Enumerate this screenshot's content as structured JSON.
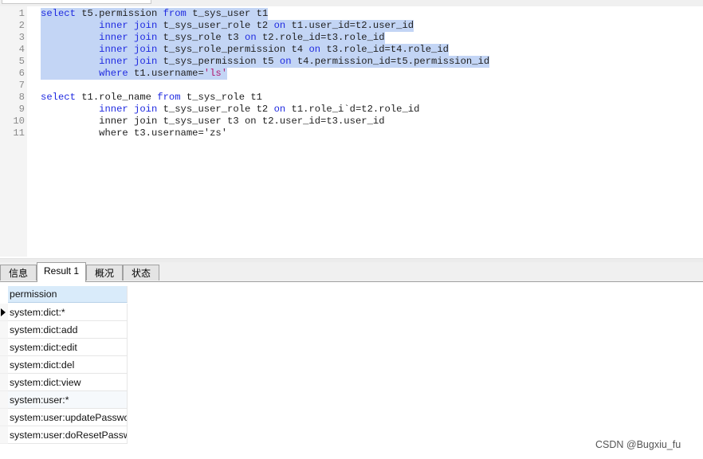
{
  "editor": {
    "lines": [
      {
        "num": "1",
        "selected": true,
        "tokens": [
          {
            "t": "select",
            "c": "kw"
          },
          {
            "t": " t5.permission "
          },
          {
            "t": "from",
            "c": "kw"
          },
          {
            "t": " t_sys_user t1"
          }
        ]
      },
      {
        "num": "2",
        "selected": true,
        "tokens": [
          {
            "t": "          "
          },
          {
            "t": "inner join",
            "c": "kw"
          },
          {
            "t": " t_sys_user_role t2 "
          },
          {
            "t": "on",
            "c": "kw"
          },
          {
            "t": " t1.user_id=t2.user_id"
          }
        ]
      },
      {
        "num": "3",
        "selected": true,
        "tokens": [
          {
            "t": "          "
          },
          {
            "t": "inner join",
            "c": "kw"
          },
          {
            "t": " t_sys_role t3 "
          },
          {
            "t": "on",
            "c": "kw"
          },
          {
            "t": " t2.role_id=t3.role_id"
          }
        ]
      },
      {
        "num": "4",
        "selected": true,
        "tokens": [
          {
            "t": "          "
          },
          {
            "t": "inner join",
            "c": "kw"
          },
          {
            "t": " t_sys_role_permission t4 "
          },
          {
            "t": "on",
            "c": "kw"
          },
          {
            "t": " t3.role_id=t4.role_id"
          }
        ]
      },
      {
        "num": "5",
        "selected": true,
        "tokens": [
          {
            "t": "          "
          },
          {
            "t": "inner join",
            "c": "kw"
          },
          {
            "t": " t_sys_permission t5 "
          },
          {
            "t": "on",
            "c": "kw"
          },
          {
            "t": " t4.permission_id=t5.permission_id"
          }
        ]
      },
      {
        "num": "6",
        "selected": true,
        "tokens": [
          {
            "t": "          "
          },
          {
            "t": "where",
            "c": "kw"
          },
          {
            "t": " t1.username="
          },
          {
            "t": "'ls'",
            "c": "str"
          }
        ]
      },
      {
        "num": "7",
        "selected": false,
        "tokens": []
      },
      {
        "num": "8",
        "selected": false,
        "tokens": [
          {
            "t": "select",
            "c": "kw"
          },
          {
            "t": " t1.role_name "
          },
          {
            "t": "from",
            "c": "kw"
          },
          {
            "t": " t_sys_role t1"
          }
        ]
      },
      {
        "num": "9",
        "selected": false,
        "tokens": [
          {
            "t": "          "
          },
          {
            "t": "inner join",
            "c": "kw"
          },
          {
            "t": " t_sys_user_role t2 "
          },
          {
            "t": "on",
            "c": "kw"
          },
          {
            "t": " t1.role_i`d=t2.role_id"
          }
        ]
      },
      {
        "num": "10",
        "selected": false,
        "tokens": [
          {
            "t": "          inner join t_sys_user t3 on t2.user_id=t3.user_id"
          }
        ]
      },
      {
        "num": "11",
        "selected": false,
        "tokens": [
          {
            "t": "          where t3.username='zs'"
          }
        ]
      }
    ]
  },
  "tabs": [
    {
      "label": "信息",
      "active": false
    },
    {
      "label": "Result 1",
      "active": true
    },
    {
      "label": "概况",
      "active": false
    },
    {
      "label": "状态",
      "active": false
    }
  ],
  "result": {
    "column": "permission",
    "rows": [
      "system:dict:*",
      "system:dict:add",
      "system:dict:edit",
      "system:dict:del",
      "system:dict:view",
      "system:user:*",
      "system:user:updatePassword",
      "system:user:doResetPassword"
    ],
    "current_row": 0
  },
  "watermark": "CSDN @Bugxiu_fu",
  "colors": {
    "keyword": "#1f2ae0",
    "string": "#b0186e",
    "selection": "#c3d5f5",
    "header": "#d9ebfa"
  }
}
